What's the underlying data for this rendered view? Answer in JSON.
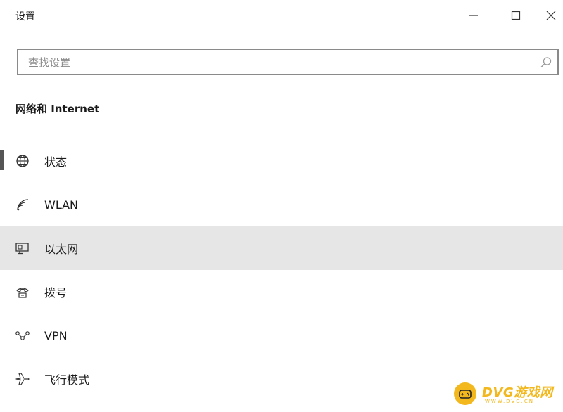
{
  "window": {
    "title": "设置",
    "controls": {
      "minimize": "minimize-icon",
      "maximize": "maximize-icon",
      "close": "close-icon"
    }
  },
  "search": {
    "placeholder": "查找设置",
    "value": "",
    "icon": "search-icon"
  },
  "section": {
    "title": "网络和 Internet"
  },
  "nav": {
    "items": [
      {
        "label": "状态",
        "icon": "globe-icon",
        "selected": true,
        "hovered": false
      },
      {
        "label": "WLAN",
        "icon": "wifi-icon",
        "selected": false,
        "hovered": false
      },
      {
        "label": "以太网",
        "icon": "ethernet-monitor-icon",
        "selected": false,
        "hovered": true
      },
      {
        "label": "拨号",
        "icon": "dialup-phone-icon",
        "selected": false,
        "hovered": false
      },
      {
        "label": "VPN",
        "icon": "vpn-icon",
        "selected": false,
        "hovered": false
      },
      {
        "label": "飞行模式",
        "icon": "airplane-icon",
        "selected": false,
        "hovered": false
      }
    ]
  },
  "watermark": {
    "text": "DVG游戏网",
    "subtext": "WWW.DVG.CN",
    "icon": "gamepad-icon",
    "color": "#f2b81d"
  },
  "colors": {
    "background": "#ffffff",
    "hover_row": "#e6e6e6",
    "selection_indicator": "#555555",
    "search_border": "#8a8a8a"
  }
}
